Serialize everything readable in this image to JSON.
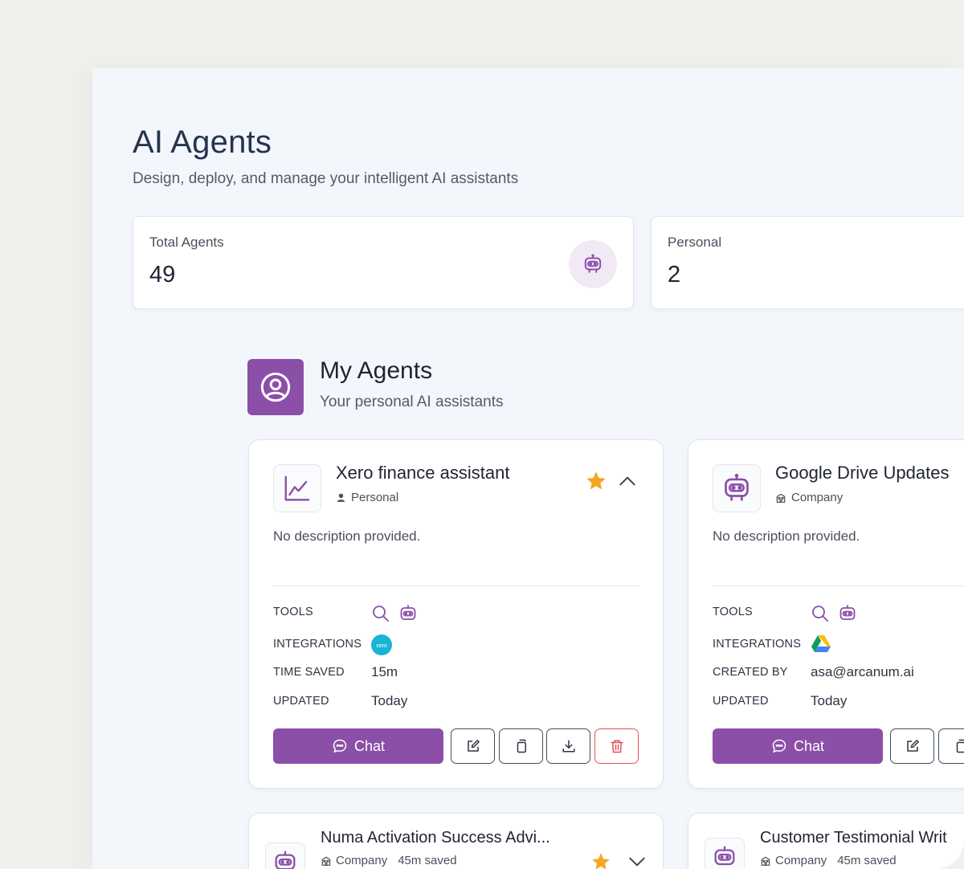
{
  "page": {
    "title": "AI Agents",
    "subtitle": "Design, deploy, and manage your intelligent AI assistants"
  },
  "stats": [
    {
      "label": "Total Agents",
      "value": "49",
      "icon": "robot-icon"
    },
    {
      "label": "Personal",
      "value": "2"
    }
  ],
  "section": {
    "title": "My Agents",
    "subtitle": "Your personal AI assistants",
    "icon": "user-circle-icon"
  },
  "labels": {
    "tools": "TOOLS",
    "integrations": "INTEGRATIONS",
    "time_saved": "TIME SAVED",
    "created_by": "CREATED BY",
    "updated": "UPDATED",
    "chat": "Chat"
  },
  "agents": [
    {
      "name": "Xero finance assistant",
      "type": "Personal",
      "description": "No description provided.",
      "time_saved": "15m",
      "updated": "Today",
      "integration": "xero",
      "favorite": true,
      "expanded": true
    },
    {
      "name": "Google Drive Updates",
      "type": "Company",
      "description": "No description provided.",
      "created_by": "asa@arcanum.ai",
      "updated": "Today",
      "integration": "google-drive"
    },
    {
      "name": "Numa Activation Success Advi...",
      "type": "Company",
      "saved": "45m saved",
      "favorite": true,
      "expanded": false
    },
    {
      "name": "Customer Testimonial Writ",
      "type": "Company",
      "saved": "45m saved"
    }
  ],
  "colors": {
    "accent": "#8b4fa8",
    "star": "#f5a623",
    "danger": "#e2525a"
  }
}
